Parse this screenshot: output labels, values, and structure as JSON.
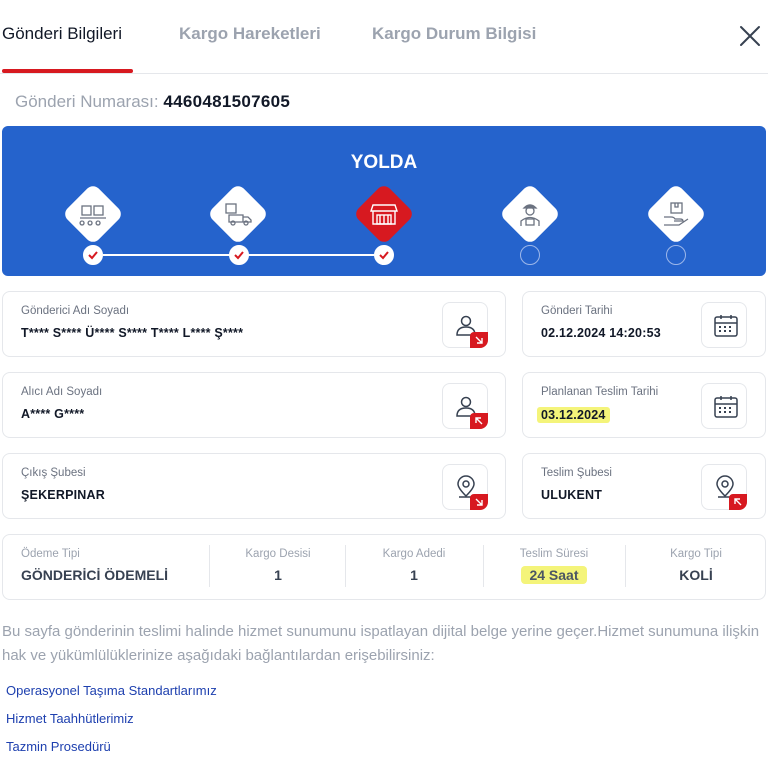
{
  "tabs": [
    {
      "label": "Gönderi Bilgileri",
      "active": true
    },
    {
      "label": "Kargo Hareketleri",
      "active": false
    },
    {
      "label": "Kargo Durum Bilgisi",
      "active": false
    }
  ],
  "tracking": {
    "label": "Gönderi Numarası:",
    "number": "4460481507605"
  },
  "status": {
    "title": "YOLDA",
    "steps": [
      {
        "icon": "boxes-conveyor-icon",
        "state": "done"
      },
      {
        "icon": "truck-loading-icon",
        "state": "done"
      },
      {
        "icon": "branch-store-icon",
        "state": "done",
        "current": true
      },
      {
        "icon": "courier-icon",
        "state": "pending"
      },
      {
        "icon": "hand-package-icon",
        "state": "pending"
      }
    ]
  },
  "cards": {
    "sender": {
      "label": "Gönderici Adı Soyadı",
      "value": "T**** S**** Ü**** S**** T**** L**** Ş****",
      "icon": "user-icon"
    },
    "send_date": {
      "label": "Gönderi Tarihi",
      "value": "02.12.2024 14:20:53",
      "icon": "calendar-icon"
    },
    "receiver": {
      "label": "Alıcı Adı Soyadı",
      "value": "A**** G****",
      "icon": "user-icon"
    },
    "planned_date": {
      "label": "Planlanan Teslim Tarihi",
      "value": "03.12.2024",
      "icon": "calendar-icon"
    },
    "origin_branch": {
      "label": "Çıkış Şubesi",
      "value": "ŞEKERPINAR",
      "icon": "location-pin-icon"
    },
    "delivery_branch": {
      "label": "Teslim Şubesi",
      "value": "ULUKENT",
      "icon": "location-pin-icon"
    }
  },
  "summary": [
    {
      "label": "Ödeme Tipi",
      "value": "GÖNDERİCİ ÖDEMELİ"
    },
    {
      "label": "Kargo Desisi",
      "value": "1"
    },
    {
      "label": "Kargo Adedi",
      "value": "1"
    },
    {
      "label": "Teslim Süresi",
      "value": "24 Saat"
    },
    {
      "label": "Kargo Tipi",
      "value": "KOLİ"
    }
  ],
  "disclaimer": "Bu sayfa gönderinin teslimi halinde hizmet sunumunu ispatlayan dijital belge yerine geçer.Hizmet sunumuna ilişkin hak ve yükümlülüklerinize aşağıdaki bağlantılardan erişebilirsiniz:",
  "links": [
    {
      "label": "Operasyonel Taşıma Standartlarımız"
    },
    {
      "label": "Hizmet Taahhütlerimiz"
    },
    {
      "label": "Tazmin Prosedürü"
    }
  ],
  "colors": {
    "brand_red": "#d71920",
    "banner_blue": "#2563cc",
    "highlight": "#f4f47a",
    "link": "#1e40af"
  }
}
